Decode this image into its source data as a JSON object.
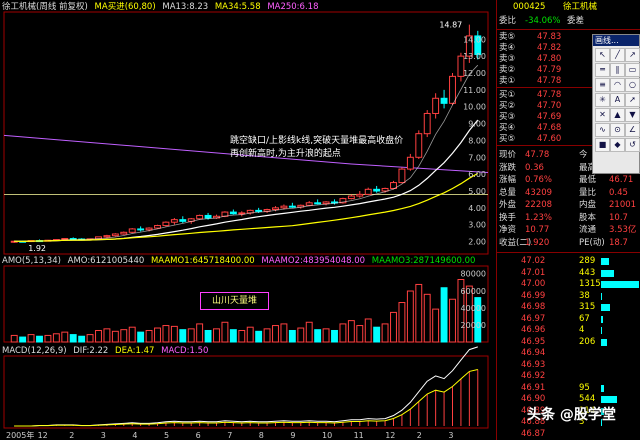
{
  "header": {
    "main": [
      "徐工机械(周线 前复权)",
      "MA买进(60,80)",
      "MA13:8.23",
      "MA34:5.58",
      "MA250:6.18"
    ],
    "volume": [
      "AMO(5,13,34)",
      "AMO:6121005440",
      "MAAMO1:645718400.00",
      "MAAMO2:483954048.00",
      "MAAMO3:287149600.00"
    ],
    "macd": [
      "MACD(12,26,9)",
      "DIF:2.22",
      "DEA:1.47",
      "MACD:1.50"
    ]
  },
  "price_axis": [
    "14.00",
    "13.00",
    "12.00",
    "11.00",
    "10.00",
    "9.00",
    "8.00",
    "7.00",
    "6.00",
    "5.00",
    "4.00",
    "3.00",
    "2.00"
  ],
  "volume_axis": [
    "80000",
    "60000",
    "40000",
    "20000"
  ],
  "time_axis": [
    "2005年",
    "12",
    "2",
    "3",
    "4",
    "5",
    "6",
    "7",
    "8",
    "9",
    "10",
    "11",
    "12",
    "2",
    "3"
  ],
  "high_label": "14.87",
  "low_label": "1.92",
  "annotation": [
    "跳空缺口/上影线k线,突破天量堆最高收盘价",
    "再创新高时,为主升浪的起点"
  ],
  "box_label": "山川天量堆",
  "quote": {
    "code": "000425",
    "name": "徐工机械",
    "webi_label": "委比",
    "webi": "-34.06%",
    "weicha_label": "委差",
    "sells": [
      {
        "label": "卖⑤",
        "price": "47.83"
      },
      {
        "label": "卖④",
        "price": "47.82"
      },
      {
        "label": "卖③",
        "price": "47.80"
      },
      {
        "label": "卖②",
        "price": "47.79"
      },
      {
        "label": "卖①",
        "price": "47.78"
      }
    ],
    "buys": [
      {
        "label": "买①",
        "price": "47.78"
      },
      {
        "label": "买②",
        "price": "47.70"
      },
      {
        "label": "买③",
        "price": "47.69"
      },
      {
        "label": "买④",
        "price": "47.68"
      },
      {
        "label": "买⑤",
        "price": "47.60"
      }
    ],
    "stats": [
      {
        "k": "现价",
        "v": "47.78",
        "k2": "今",
        "v2": ""
      },
      {
        "k": "涨跌",
        "v": "0.36",
        "k2": "最高",
        "v2": ""
      },
      {
        "k": "涨幅",
        "v": "0.76%",
        "k2": "最低",
        "v2": "46.71"
      },
      {
        "k": "总量",
        "v": "43209",
        "k2": "量比",
        "v2": "0.45"
      },
      {
        "k": "外盘",
        "v": "22208",
        "k2": "内盘",
        "v2": "21001"
      },
      {
        "k": "换手",
        "v": "1.23%",
        "k2": "股本",
        "v2": "10.7"
      },
      {
        "k": "净资",
        "v": "10.77",
        "k2": "流通",
        "v2": "3.53亿"
      },
      {
        "k": "收益(二)",
        "v": "1.920",
        "k2": "PE(动)",
        "v2": "18.7"
      }
    ],
    "ticks": [
      {
        "p": "47.02",
        "v": "289"
      },
      {
        "p": "47.01",
        "v": "443"
      },
      {
        "p": "47.00",
        "v": "1315"
      },
      {
        "p": "46.99",
        "v": "38"
      },
      {
        "p": "46.98",
        "v": "315"
      },
      {
        "p": "46.97",
        "v": "67"
      },
      {
        "p": "46.96",
        "v": "4"
      },
      {
        "p": "46.95",
        "v": "206"
      },
      {
        "p": "46.94",
        "v": ""
      },
      {
        "p": "46.93",
        "v": ""
      },
      {
        "p": "46.92",
        "v": ""
      },
      {
        "p": "46.91",
        "v": "95"
      },
      {
        "p": "46.90",
        "v": "544"
      },
      {
        "p": "46.89",
        "v": "114"
      },
      {
        "p": "46.88",
        "v": "3"
      },
      {
        "p": "46.87",
        "v": ""
      }
    ]
  },
  "toolbox_title": "画线...",
  "toolbox_icons": [
    "cursor",
    "line",
    "ray",
    "channel",
    "parallel",
    "rect",
    "fib",
    "arc",
    "circle",
    "gann",
    "text",
    "arrow",
    "delete",
    "up",
    "down",
    "wave",
    "cycle",
    "angle",
    "lock",
    "color",
    "reset"
  ],
  "watermark": "头条 @股学堂",
  "colors": {
    "up": "#ff4040",
    "down": "#00ffff",
    "ma_white": "#ffffff",
    "ma_yellow": "#ffff00",
    "ma_purple": "#c060ff"
  },
  "chart_data": {
    "type": "candlestick",
    "note_bars": "weekly candles, prices in yuan",
    "ohlc": [
      [
        1.98,
        2.05,
        1.92,
        2.02
      ],
      [
        2.02,
        2.06,
        1.98,
        2.0
      ],
      [
        2.0,
        2.08,
        1.97,
        2.06
      ],
      [
        2.06,
        2.12,
        2.0,
        2.05
      ],
      [
        2.05,
        2.1,
        2.0,
        2.08
      ],
      [
        2.08,
        2.15,
        2.05,
        2.12
      ],
      [
        2.12,
        2.2,
        2.08,
        2.18
      ],
      [
        2.18,
        2.25,
        2.1,
        2.15
      ],
      [
        2.15,
        2.2,
        2.1,
        2.12
      ],
      [
        2.12,
        2.18,
        2.06,
        2.16
      ],
      [
        2.16,
        2.3,
        2.12,
        2.28
      ],
      [
        2.28,
        2.4,
        2.2,
        2.35
      ],
      [
        2.35,
        2.5,
        2.3,
        2.45
      ],
      [
        2.45,
        2.6,
        2.4,
        2.55
      ],
      [
        2.55,
        2.8,
        2.5,
        2.75
      ],
      [
        2.75,
        2.9,
        2.6,
        2.7
      ],
      [
        2.7,
        2.85,
        2.6,
        2.8
      ],
      [
        2.8,
        3.0,
        2.75,
        2.95
      ],
      [
        2.95,
        3.2,
        2.9,
        3.15
      ],
      [
        3.15,
        3.4,
        3.0,
        3.3
      ],
      [
        3.3,
        3.5,
        3.1,
        3.2
      ],
      [
        3.2,
        3.4,
        3.05,
        3.35
      ],
      [
        3.35,
        3.6,
        3.3,
        3.55
      ],
      [
        3.55,
        3.7,
        3.3,
        3.4
      ],
      [
        3.4,
        3.6,
        3.35,
        3.5
      ],
      [
        3.5,
        3.8,
        3.45,
        3.75
      ],
      [
        3.75,
        3.9,
        3.6,
        3.65
      ],
      [
        3.65,
        3.8,
        3.5,
        3.7
      ],
      [
        3.7,
        3.9,
        3.6,
        3.85
      ],
      [
        3.85,
        4.0,
        3.7,
        3.8
      ],
      [
        3.8,
        3.95,
        3.7,
        3.9
      ],
      [
        3.9,
        4.1,
        3.8,
        4.0
      ],
      [
        4.0,
        4.2,
        3.9,
        4.1
      ],
      [
        4.1,
        4.3,
        4.0,
        4.05
      ],
      [
        4.05,
        4.2,
        3.95,
        4.15
      ],
      [
        4.15,
        4.4,
        4.1,
        4.3
      ],
      [
        4.3,
        4.5,
        4.2,
        4.25
      ],
      [
        4.25,
        4.4,
        4.15,
        4.35
      ],
      [
        4.35,
        4.5,
        4.2,
        4.3
      ],
      [
        4.3,
        4.6,
        4.25,
        4.55
      ],
      [
        4.55,
        4.8,
        4.5,
        4.7
      ],
      [
        4.7,
        5.0,
        4.6,
        4.8
      ],
      [
        4.8,
        5.2,
        4.75,
        5.1
      ],
      [
        5.1,
        5.3,
        4.9,
        5.0
      ],
      [
        5.0,
        5.2,
        4.9,
        5.15
      ],
      [
        5.15,
        5.6,
        5.1,
        5.5
      ],
      [
        5.5,
        6.4,
        5.45,
        6.3
      ],
      [
        6.3,
        7.2,
        6.2,
        7.0
      ],
      [
        7.0,
        8.6,
        6.9,
        8.4
      ],
      [
        8.4,
        9.8,
        8.2,
        9.6
      ],
      [
        9.6,
        10.8,
        9.3,
        10.5
      ],
      [
        10.5,
        11.0,
        9.9,
        10.2
      ],
      [
        10.2,
        12.0,
        10.1,
        11.8
      ],
      [
        11.8,
        13.2,
        11.5,
        13.0
      ],
      [
        13.0,
        14.87,
        12.6,
        14.2
      ],
      [
        14.2,
        14.5,
        12.8,
        13.1
      ]
    ],
    "volume": [
      8,
      6,
      9,
      7,
      8,
      10,
      12,
      9,
      7,
      9,
      14,
      16,
      13,
      15,
      18,
      12,
      14,
      17,
      20,
      19,
      15,
      16,
      22,
      14,
      16,
      24,
      15,
      14,
      18,
      13,
      16,
      20,
      22,
      14,
      17,
      24,
      15,
      16,
      14,
      22,
      26,
      20,
      28,
      18,
      22,
      36,
      48,
      62,
      70,
      58,
      40,
      66,
      52,
      76,
      68,
      54
    ],
    "macd_hist": [
      0,
      0,
      0,
      0.01,
      0.01,
      0.02,
      0.02,
      0.02,
      0.01,
      0.01,
      0.02,
      0.03,
      0.04,
      0.05,
      0.06,
      0.05,
      0.05,
      0.06,
      0.08,
      0.09,
      0.08,
      0.08,
      0.09,
      0.08,
      0.08,
      0.1,
      0.09,
      0.08,
      0.09,
      0.08,
      0.08,
      0.09,
      0.1,
      0.09,
      0.09,
      0.1,
      0.09,
      0.09,
      0.08,
      0.1,
      0.12,
      0.12,
      0.14,
      0.13,
      0.14,
      0.2,
      0.3,
      0.45,
      0.65,
      0.85,
      0.95,
      0.9,
      1.05,
      1.25,
      1.45,
      1.5
    ],
    "ylim_price": [
      1.5,
      15.5
    ],
    "hline": 4.8
  }
}
